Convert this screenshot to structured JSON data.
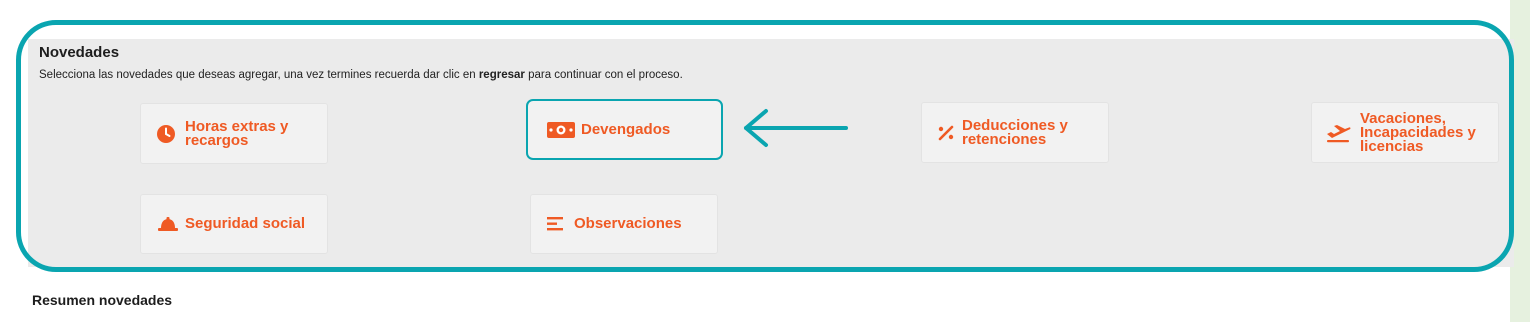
{
  "header": {
    "title": "Novedades",
    "subtitle_prefix": "Selecciona las novedades que deseas agregar, una vez termines recuerda dar clic en ",
    "subtitle_bold": "regresar",
    "subtitle_suffix": " para continuar con el proceso."
  },
  "cards": {
    "horas_extras": {
      "line1": "Horas extras y",
      "line2": "recargos",
      "icon": "clock-icon"
    },
    "devengados": {
      "label": "Devengados",
      "icon": "money-icon",
      "selected": true
    },
    "deducciones": {
      "line1": "Deducciones y",
      "line2": "retenciones",
      "icon": "percent-icon"
    },
    "vacaciones": {
      "line1": "Vacaciones,",
      "line2": "Incapacidades y",
      "line3": "licencias",
      "icon": "plane-icon"
    },
    "seguridad": {
      "label": "Seguridad social",
      "icon": "hardhat-icon"
    },
    "observaciones": {
      "label": "Observaciones",
      "icon": "lines-icon"
    }
  },
  "summary": {
    "title": "Resumen novedades"
  },
  "colors": {
    "accent": "#ef5a24",
    "highlight": "#0aa5b0",
    "panel": "#ebebeb"
  }
}
